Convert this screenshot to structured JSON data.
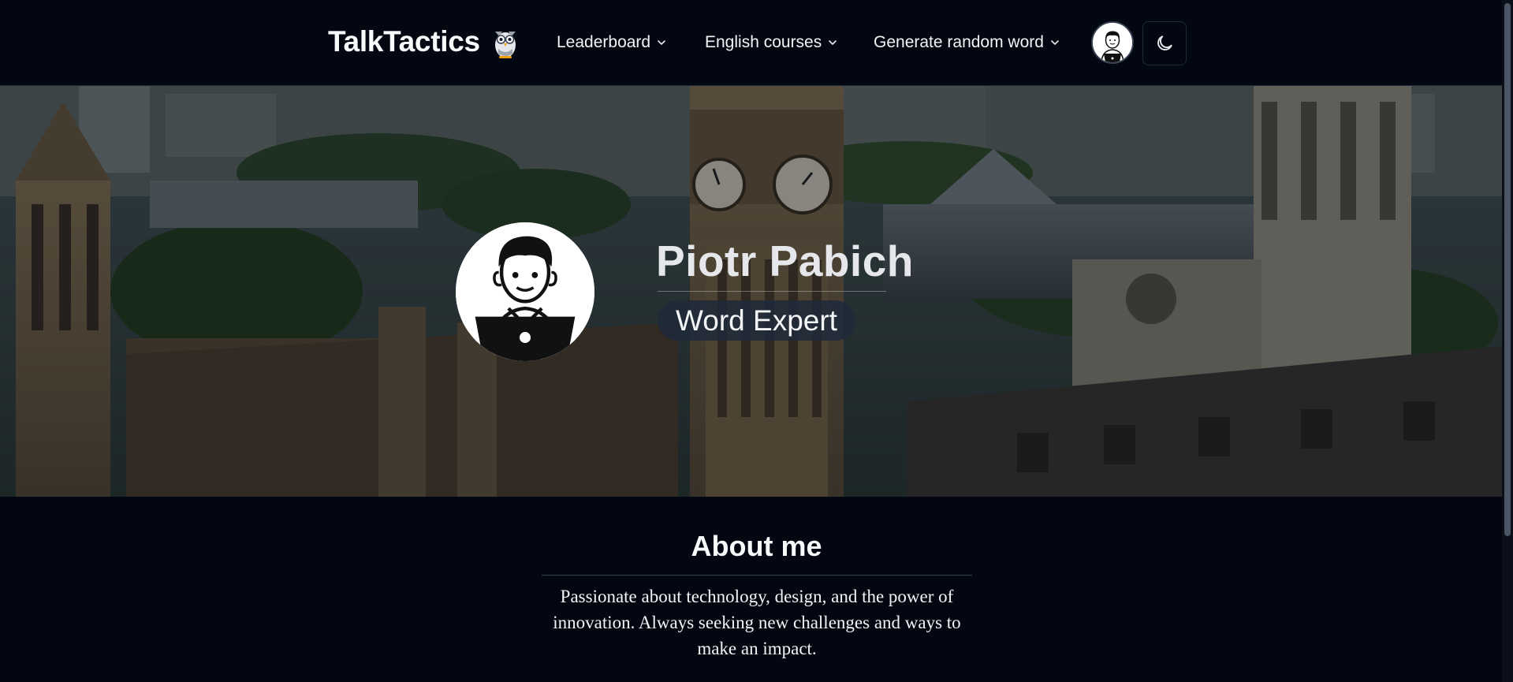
{
  "navbar": {
    "brand": "TalkTactics",
    "brand_icon": "owl-logo-icon",
    "items": [
      {
        "label": "Leaderboard",
        "icon": "chevron-down-icon"
      },
      {
        "label": "English courses",
        "icon": "chevron-down-icon"
      },
      {
        "label": "Generate random word",
        "icon": "chevron-down-icon"
      }
    ],
    "avatar_icon": "user-avatar-icon",
    "theme_toggle_icon": "moon-icon"
  },
  "profile": {
    "name": "Piotr Pabich",
    "badge": "Word Expert",
    "avatar_icon": "user-avatar-icon",
    "background_icon": "london-skyline-photo"
  },
  "about": {
    "title": "About me",
    "text": "Passionate about technology, design, and the power of innovation. Always seeking new challenges and ways to make an impact."
  },
  "colors": {
    "background": "#030712",
    "badge_bg": "#1e293b",
    "text": "#f3f4f6"
  }
}
